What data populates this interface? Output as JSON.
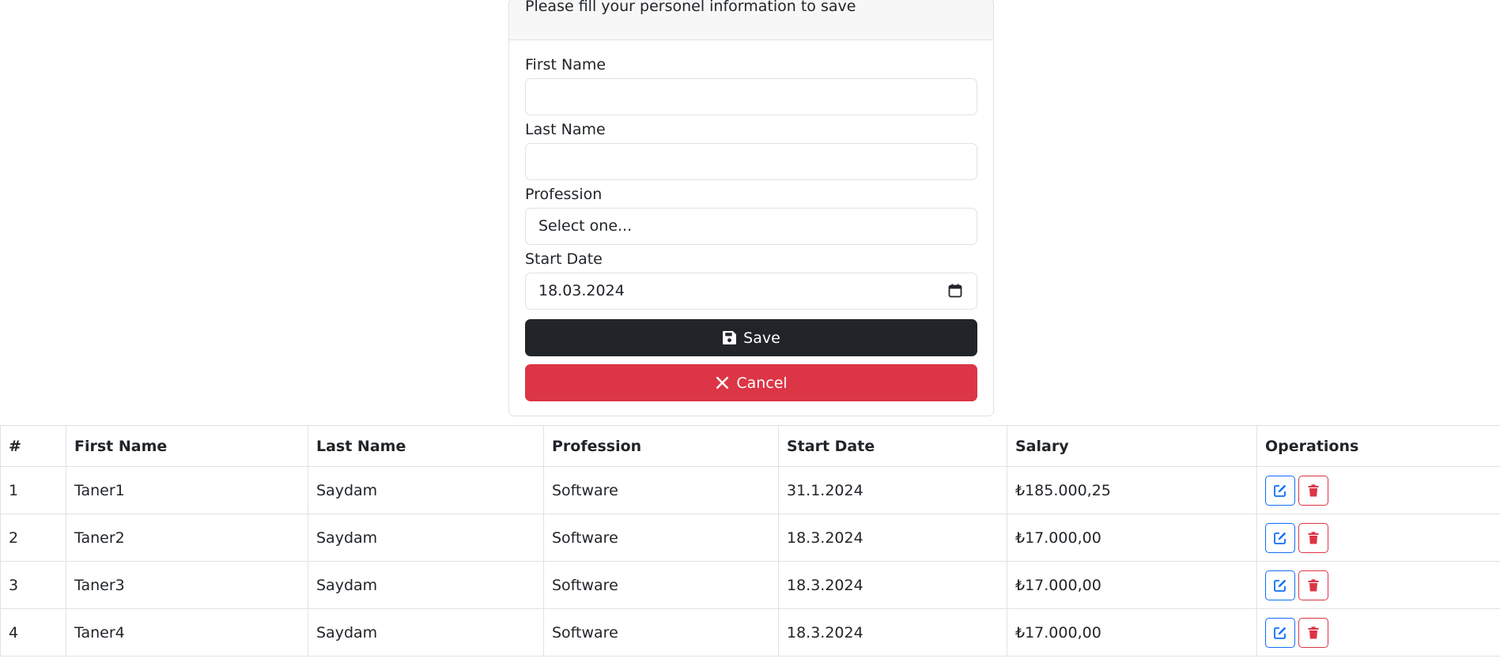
{
  "form": {
    "header": "Please fill your personel information to save",
    "first_name_label": "First Name",
    "first_name_value": "",
    "last_name_label": "Last Name",
    "last_name_value": "",
    "profession_label": "Profession",
    "profession_value": "Select one...",
    "start_date_label": "Start Date",
    "start_date_value": "18.03.2024",
    "save_label": "Save",
    "cancel_label": "Cancel"
  },
  "table": {
    "headers": [
      "#",
      "First Name",
      "Last Name",
      "Profession",
      "Start Date",
      "Salary",
      "Operations"
    ],
    "rows": [
      {
        "num": "1",
        "first": "Taner1",
        "last": "Saydam",
        "profession": "Software",
        "start": "31.1.2024",
        "salary": "₺185.000,25"
      },
      {
        "num": "2",
        "first": "Taner2",
        "last": "Saydam",
        "profession": "Software",
        "start": "18.3.2024",
        "salary": "₺17.000,00"
      },
      {
        "num": "3",
        "first": "Taner3",
        "last": "Saydam",
        "profession": "Software",
        "start": "18.3.2024",
        "salary": "₺17.000,00"
      },
      {
        "num": "4",
        "first": "Taner4",
        "last": "Saydam",
        "profession": "Software",
        "start": "18.3.2024",
        "salary": "₺17.000,00"
      }
    ]
  },
  "colors": {
    "save": "#212529",
    "cancel": "#dc3545",
    "edit": "#0d6efd",
    "delete": "#dc3545"
  },
  "icons": {
    "save": "floppy-disk-icon",
    "cancel": "x-icon",
    "calendar": "calendar-icon",
    "edit": "pen-to-square-icon",
    "delete": "trash-icon"
  }
}
